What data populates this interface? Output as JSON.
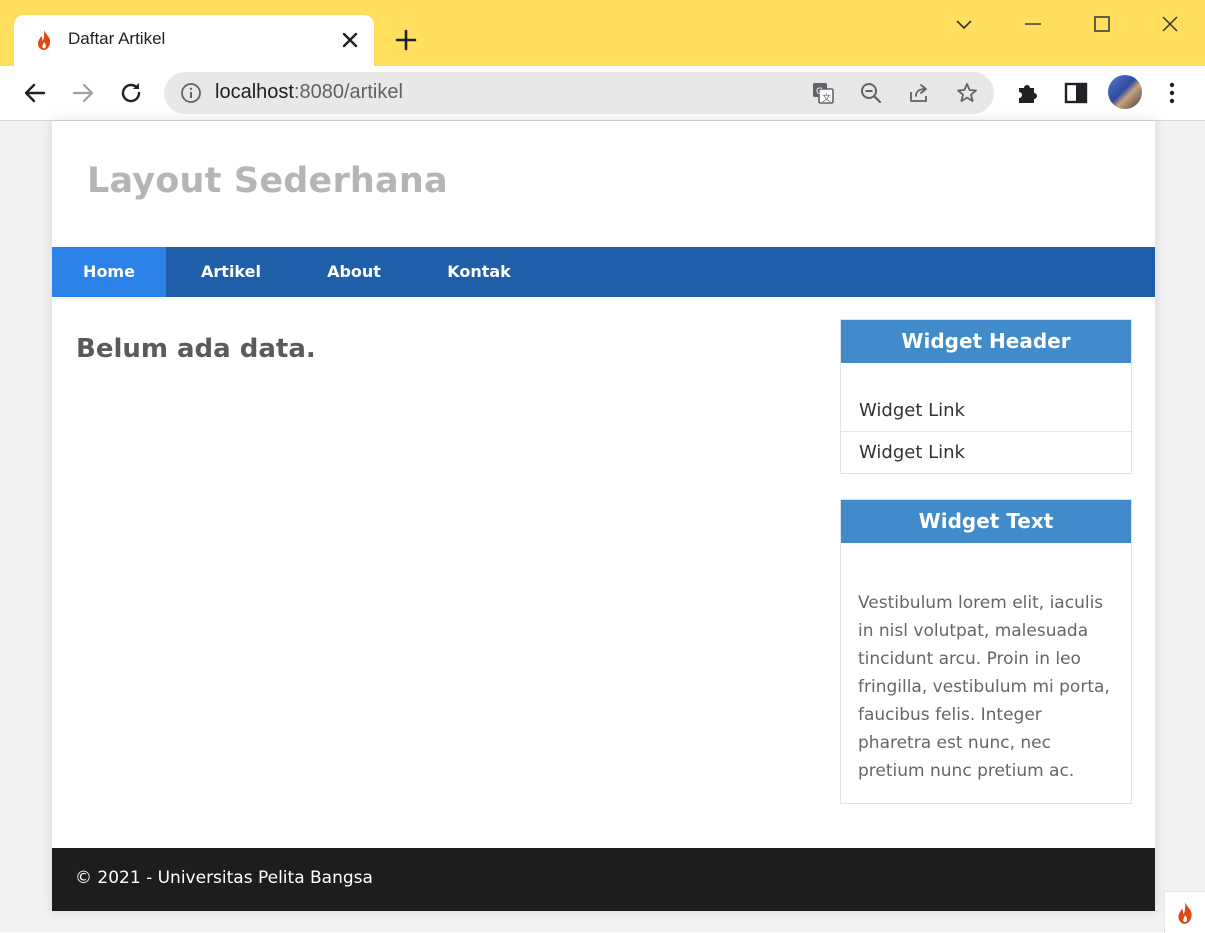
{
  "browser": {
    "tab_title": "Daftar Artikel",
    "url_host": "localhost",
    "url_rest": ":8080/artikel",
    "icons": {
      "favicon": "codeigniter-flame-icon",
      "tab_close": "close-icon",
      "new_tab": "plus-icon",
      "back": "back-arrow-icon",
      "forward": "forward-arrow-icon",
      "reload": "reload-icon",
      "site_info": "info-icon",
      "translate": "translate-icon",
      "zoom": "zoom-out-icon",
      "share": "share-icon",
      "bookmark": "star-icon",
      "extensions": "puzzle-icon",
      "side_panel": "side-panel-icon",
      "menu": "kebab-menu-icon"
    },
    "colors": {
      "titlebar": "#ffdf5d"
    }
  },
  "site": {
    "title": "Layout Sederhana",
    "nav": [
      {
        "label": "Home",
        "active": true
      },
      {
        "label": "Artikel",
        "active": false
      },
      {
        "label": "About",
        "active": false
      },
      {
        "label": "Kontak",
        "active": false
      }
    ],
    "main": {
      "message": "Belum ada data."
    },
    "widgets": {
      "links_header": "Widget Header",
      "links": [
        "Widget Link",
        "Widget Link"
      ],
      "text_header": "Widget Text",
      "text": "Vestibulum lorem elit, iaculis in nisl volutpat, malesuada tincidunt arcu. Proin in leo fringilla, vestibulum mi porta, faucibus felis. Integer pharetra est nunc, nec pretium nunc pretium ac."
    },
    "footer": "© 2021 - Universitas Pelita Bangsa",
    "colors": {
      "nav_bg": "#1f5faa",
      "nav_active": "#2b83ea",
      "widget_header": "#428bca",
      "footer_bg": "#1d1d1d"
    }
  }
}
